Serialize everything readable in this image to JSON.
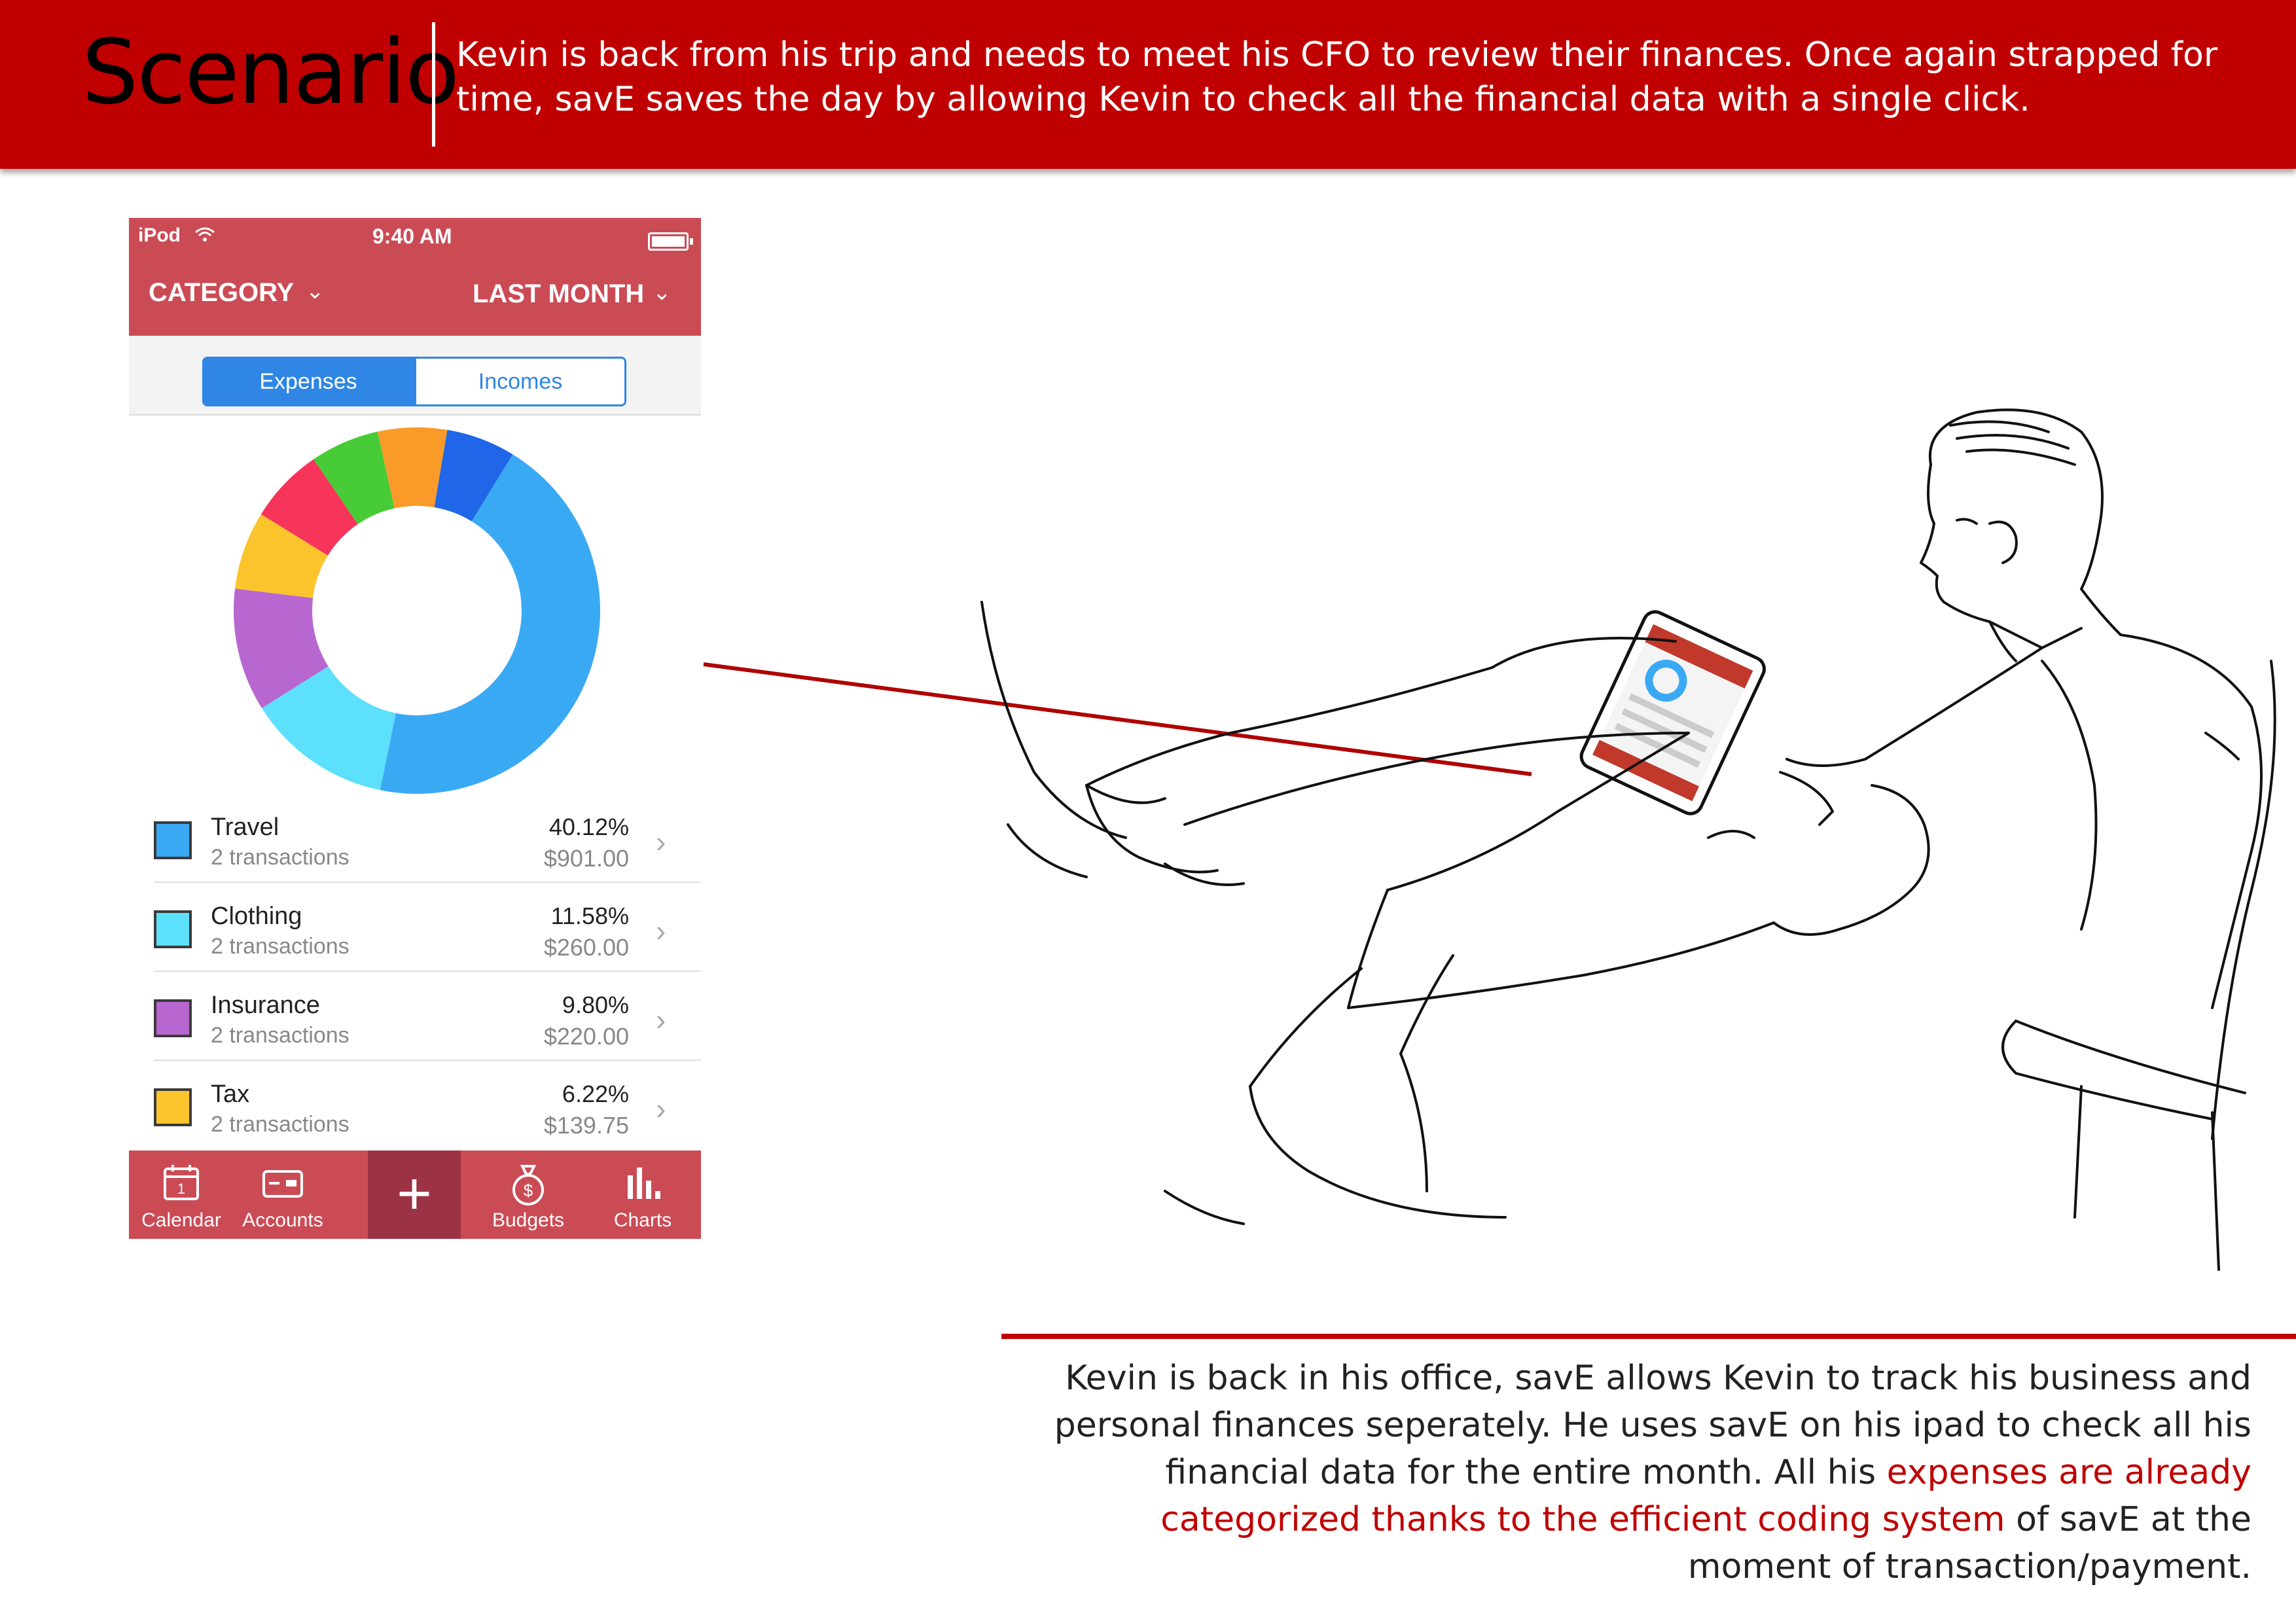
{
  "header": {
    "title": "Scenario",
    "description": "Kevin is back from his trip and needs to meet his CFO to review their finances. Once again strapped for time, savE saves the day  by allowing Kevin to check all the financial data with a single click."
  },
  "phone": {
    "status": {
      "carrier": "iPod",
      "wifi_icon": "wifi-icon",
      "time": "9:40 AM"
    },
    "nav": {
      "category_label": "CATEGORY",
      "period_label": "LAST MONTH"
    },
    "segments": {
      "expenses": "Expenses",
      "incomes": "Incomes"
    },
    "categories": [
      {
        "name": "Travel",
        "sub": "2 transactions",
        "pct": "40.12%",
        "amount": "$901.00",
        "color": "#3aa9f4"
      },
      {
        "name": "Clothing",
        "sub": "2 transactions",
        "pct": "11.58%",
        "amount": "$260.00",
        "color": "#5ce0fb"
      },
      {
        "name": "Insurance",
        "sub": "2 transactions",
        "pct": "9.80%",
        "amount": "$220.00",
        "color": "#b867d0"
      },
      {
        "name": "Tax",
        "sub": "2 transactions",
        "pct": "6.22%",
        "amount": "$139.75",
        "color": "#fcc42c"
      }
    ],
    "donut_segments": [
      {
        "value": 40.12,
        "color": "#3aa9f4"
      },
      {
        "value": 11.58,
        "color": "#5ce0fb"
      },
      {
        "value": 9.8,
        "color": "#b867d0"
      },
      {
        "value": 6.22,
        "color": "#fcc42c"
      },
      {
        "value": 6.0,
        "color": "#f7345a"
      },
      {
        "value": 5.5,
        "color": "#47cc38"
      },
      {
        "value": 5.5,
        "color": "#fa9a28"
      },
      {
        "value": 5.5,
        "color": "#1f66e8"
      }
    ],
    "tabs": [
      {
        "label": "Calendar",
        "icon": "calendar-icon"
      },
      {
        "label": "Accounts",
        "icon": "wallet-icon"
      },
      {
        "label": "",
        "icon": "plus-icon"
      },
      {
        "label": "Budgets",
        "icon": "money-bag-icon"
      },
      {
        "label": "Charts",
        "icon": "bar-chart-icon"
      }
    ],
    "calendar_day": "1"
  },
  "caption": {
    "part1": "Kevin is back in his office, savE allows Kevin to track his business and personal finances seperately.  He uses savE on his ipad to check all his financial data for the entire month. All his ",
    "highlight": "expenses are already categorized thanks to the efficient coding system",
    "part2": " of savE at the moment of transaction/payment."
  },
  "colors": {
    "banner": "#c00000",
    "app_red": "#cb4b55",
    "accent_blue": "#2f86e4"
  }
}
